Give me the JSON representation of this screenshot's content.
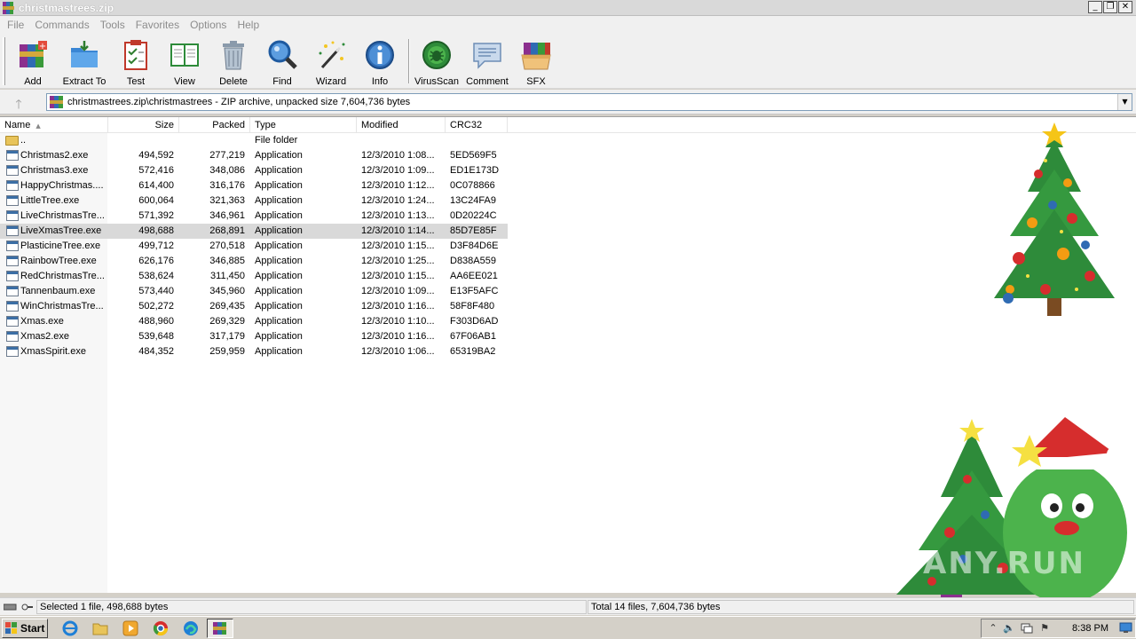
{
  "window": {
    "title": "christmastrees.zip",
    "minimize": "_",
    "restore": "❐",
    "close": "✕"
  },
  "menu": [
    "File",
    "Commands",
    "Tools",
    "Favorites",
    "Options",
    "Help"
  ],
  "toolbar": [
    {
      "label": "Add",
      "icon": "add-icon"
    },
    {
      "label": "Extract To",
      "icon": "extract-to-icon"
    },
    {
      "label": "Test",
      "icon": "test-icon"
    },
    {
      "label": "View",
      "icon": "view-icon"
    },
    {
      "label": "Delete",
      "icon": "delete-icon"
    },
    {
      "label": "Find",
      "icon": "find-icon"
    },
    {
      "label": "Wizard",
      "icon": "wizard-icon"
    },
    {
      "label": "Info",
      "icon": "info-icon"
    },
    {
      "label": "VirusScan",
      "icon": "virusscan-icon"
    },
    {
      "label": "Comment",
      "icon": "comment-icon"
    },
    {
      "label": "SFX",
      "icon": "sfx-icon"
    }
  ],
  "address": {
    "up": "🡑",
    "path": "christmastrees.zip\\christmastrees - ZIP archive, unpacked size 7,604,736 bytes",
    "dropdown": "▼"
  },
  "columns": [
    "Name",
    "Size",
    "Packed",
    "Type",
    "Modified",
    "CRC32"
  ],
  "sort_arrow": "▲",
  "files": [
    {
      "name": "..",
      "size": "",
      "packed": "",
      "type": "File folder",
      "modified": "",
      "crc": "",
      "folder": true
    },
    {
      "name": "Christmas2.exe",
      "size": "494,592",
      "packed": "277,219",
      "type": "Application",
      "modified": "12/3/2010 1:08...",
      "crc": "5ED569F5"
    },
    {
      "name": "Christmas3.exe",
      "size": "572,416",
      "packed": "348,086",
      "type": "Application",
      "modified": "12/3/2010 1:09...",
      "crc": "ED1E173D"
    },
    {
      "name": "HappyChristmas....",
      "size": "614,400",
      "packed": "316,176",
      "type": "Application",
      "modified": "12/3/2010 1:12...",
      "crc": "0C078866"
    },
    {
      "name": "LittleTree.exe",
      "size": "600,064",
      "packed": "321,363",
      "type": "Application",
      "modified": "12/3/2010 1:24...",
      "crc": "13C24FA9"
    },
    {
      "name": "LiveChristmasTre...",
      "size": "571,392",
      "packed": "346,961",
      "type": "Application",
      "modified": "12/3/2010 1:13...",
      "crc": "0D20224C"
    },
    {
      "name": "LiveXmasTree.exe",
      "size": "498,688",
      "packed": "268,891",
      "type": "Application",
      "modified": "12/3/2010 1:14...",
      "crc": "85D7E85F",
      "selected": true
    },
    {
      "name": "PlasticineTree.exe",
      "size": "499,712",
      "packed": "270,518",
      "type": "Application",
      "modified": "12/3/2010 1:15...",
      "crc": "D3F84D6E"
    },
    {
      "name": "RainbowTree.exe",
      "size": "626,176",
      "packed": "346,885",
      "type": "Application",
      "modified": "12/3/2010 1:25...",
      "crc": "D838A559"
    },
    {
      "name": "RedChristmasTre...",
      "size": "538,624",
      "packed": "311,450",
      "type": "Application",
      "modified": "12/3/2010 1:15...",
      "crc": "AA6EE021"
    },
    {
      "name": "Tannenbaum.exe",
      "size": "573,440",
      "packed": "345,960",
      "type": "Application",
      "modified": "12/3/2010 1:09...",
      "crc": "E13F5AFC"
    },
    {
      "name": "WinChristmasTre...",
      "size": "502,272",
      "packed": "269,435",
      "type": "Application",
      "modified": "12/3/2010 1:16...",
      "crc": "58F8F480"
    },
    {
      "name": "Xmas.exe",
      "size": "488,960",
      "packed": "269,329",
      "type": "Application",
      "modified": "12/3/2010 1:10...",
      "crc": "F303D6AD"
    },
    {
      "name": "Xmas2.exe",
      "size": "539,648",
      "packed": "317,179",
      "type": "Application",
      "modified": "12/3/2010 1:16...",
      "crc": "67F06AB1"
    },
    {
      "name": "XmasSpirit.exe",
      "size": "484,352",
      "packed": "259,959",
      "type": "Application",
      "modified": "12/3/2010 1:06...",
      "crc": "65319BA2"
    }
  ],
  "status": {
    "left": "Selected 1 file, 498,688 bytes",
    "right": "Total 14 files, 7,604,736 bytes"
  },
  "taskbar": {
    "start": "Start",
    "clock": "8:38 PM",
    "tray_up": "⌃",
    "tray_sound": "🔈",
    "tray_flag": "⚑"
  },
  "watermark": "ANY.RUN",
  "colors": {
    "selected_row": "#d9d9d9",
    "title_bar": "#d9d9d9",
    "tree_green": "#2e8b3a"
  }
}
